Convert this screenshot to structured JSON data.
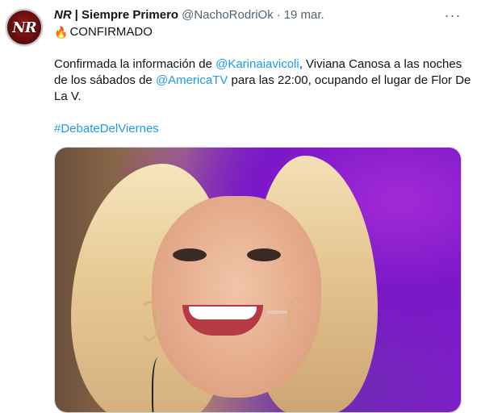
{
  "tweet": {
    "author_prefix": "NR",
    "author_name": "| Siempre Primero",
    "handle": "@NachoRodriOk",
    "separator": "·",
    "date": "19 mar.",
    "first_line_emoji": "🔥",
    "first_line_text": "CONFIRMADO",
    "paragraph": {
      "t1": "Confirmada la información de ",
      "mention1": "@Karinaiavicoli",
      "t2": ", Viviana Canosa a las noches de los sábados de ",
      "mention2": "@AmericaTV",
      "t3": " para las 22:00, ocupando el lugar de Flor De La V."
    },
    "hashtag": "#DebateDelViernes",
    "avatar_text": "NR",
    "more_label": "···"
  },
  "colors": {
    "link": "#1d9bf0",
    "text": "#0f1419",
    "meta": "#536471"
  },
  "icons": {
    "more": "more-dots-icon",
    "fire": "fire-emoji-icon"
  }
}
